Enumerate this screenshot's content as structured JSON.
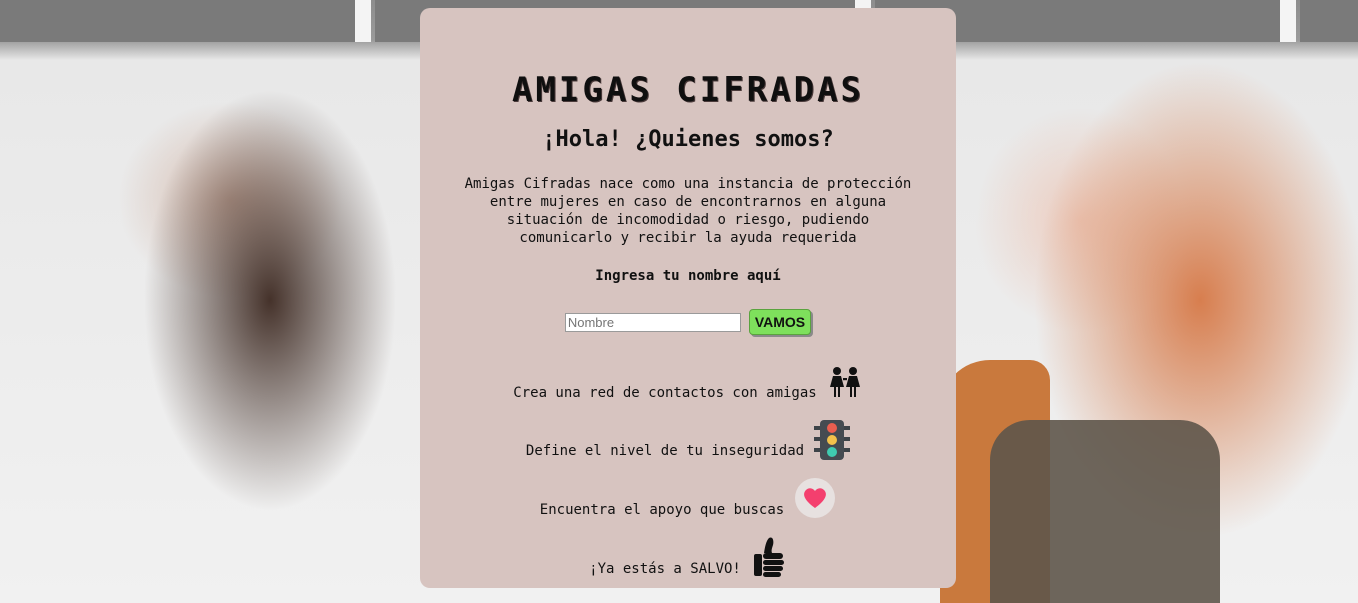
{
  "app": {
    "logo_text": "AMIGAS CIFRADAS",
    "heading": "¡Hola! ¿Quienes somos?",
    "intro": "Amigas Cifradas nace como una instancia de protección entre mujeres en caso de encontrarnos en alguna situación de incomodidad o riesgo, pudiendo comunicarlo y recibir la ayuda requerida",
    "prompt": "Ingresa tu nombre aquí"
  },
  "form": {
    "name_placeholder": "Nombre",
    "name_value": "",
    "submit_label": "VAMOS"
  },
  "features": [
    {
      "text": "Crea una red de contactos con amigas",
      "icon": "friends-icon"
    },
    {
      "text": "Define el nivel de tu inseguridad",
      "icon": "traffic-light-icon"
    },
    {
      "text": "Encuentra el apoyo que buscas",
      "icon": "heart-icon"
    },
    {
      "text": "¡Ya estás a SALVO!",
      "icon": "thumbs-up-icon"
    }
  ],
  "colors": {
    "card_bg": "#d7c4c0",
    "button_bg": "#7ee05c",
    "heart": "#f43f6e"
  }
}
